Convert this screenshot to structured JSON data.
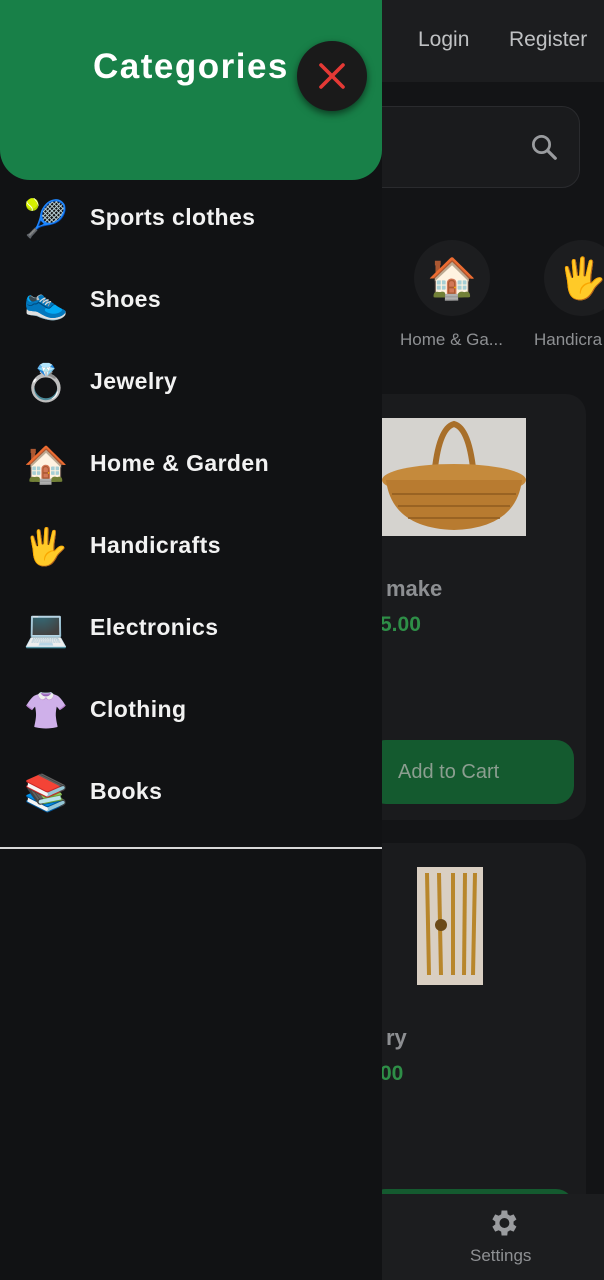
{
  "topbar": {
    "login": "Login",
    "register": "Register"
  },
  "categories_row": [
    {
      "icon": "🏠",
      "label": "Home & Ga..."
    },
    {
      "icon": "🖐",
      "label": "Handicra"
    }
  ],
  "products": [
    {
      "title_partial": "make",
      "price_partial": "5.00",
      "button": "Add to Cart"
    },
    {
      "title_partial": "ry",
      "price_partial": "00"
    }
  ],
  "bottom_nav": {
    "settings": "Settings"
  },
  "drawer": {
    "title": "Categories",
    "items": [
      {
        "icon": "🎾",
        "label": "Sports clothes"
      },
      {
        "icon": "👟",
        "label": "Shoes"
      },
      {
        "icon": "💍",
        "label": "Jewelry"
      },
      {
        "icon": "🏠",
        "label": "Home & Garden"
      },
      {
        "icon": "🖐",
        "label": "Handicrafts"
      },
      {
        "icon": "💻",
        "label": "Electronics"
      },
      {
        "icon": "👚",
        "label": "Clothing"
      },
      {
        "icon": "📚",
        "label": "Books"
      }
    ]
  },
  "colors": {
    "header_green": "#188048",
    "close_red": "#e53935",
    "price_green": "#2e8e47",
    "button_green": "#145a2f"
  }
}
